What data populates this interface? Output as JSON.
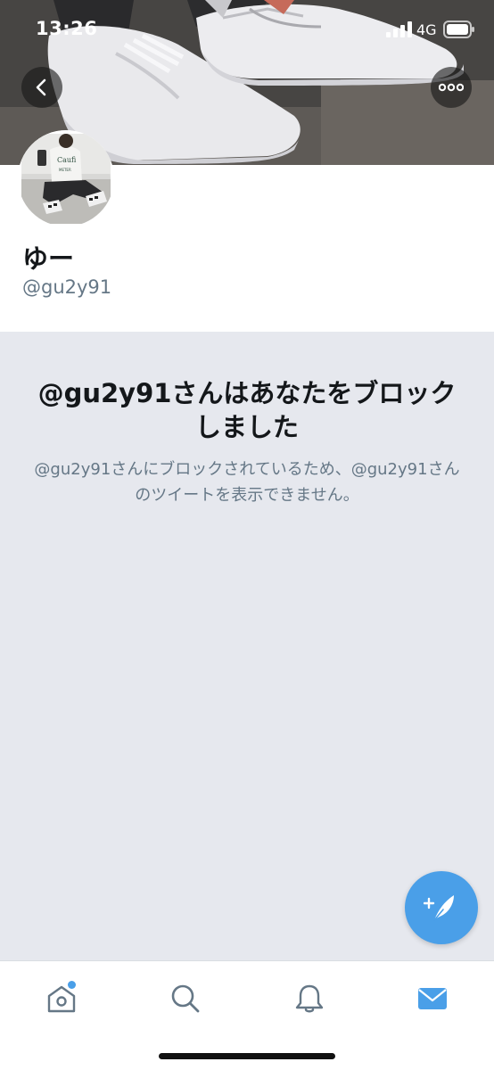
{
  "status_bar": {
    "time": "13:26",
    "network": "4G",
    "signal_icon": "signal-bars-icon",
    "battery_icon": "battery-icon"
  },
  "header": {
    "back_icon": "chevron-left-icon",
    "more_icon": "more-dots-icon"
  },
  "profile": {
    "display_name": "ゆー",
    "handle": "@gu2y91"
  },
  "blocked": {
    "title": "@gu2y91さんはあなたをブロックしました",
    "description": "@gu2y91さんにブロックされているため、@gu2y91さんのツイートを表示できません。"
  },
  "compose": {
    "icon": "compose-feather-icon"
  },
  "tabs": [
    {
      "name": "home",
      "icon": "home-icon",
      "has_unread": true
    },
    {
      "name": "search",
      "icon": "search-icon",
      "has_unread": false
    },
    {
      "name": "notifications",
      "icon": "bell-icon",
      "has_unread": false
    },
    {
      "name": "messages",
      "icon": "envelope-icon",
      "has_unread": false,
      "active": true
    }
  ],
  "colors": {
    "accent": "#4a9fe8",
    "text_primary": "#14171a",
    "text_secondary": "#657786",
    "panel_background": "#e6e8ee"
  }
}
